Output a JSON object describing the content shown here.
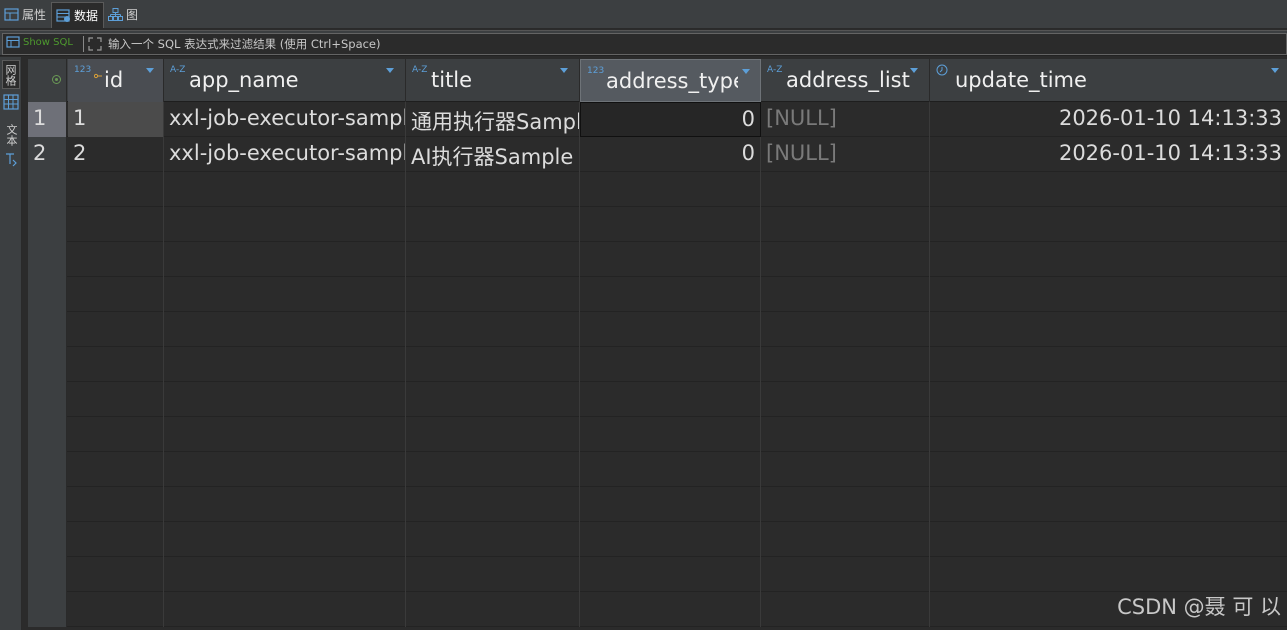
{
  "tabs": [
    {
      "label": "属性",
      "icon": "table-properties-icon"
    },
    {
      "label": "数据",
      "icon": "data-grid-icon",
      "active": true
    },
    {
      "label": "图",
      "icon": "diagram-icon"
    }
  ],
  "filter": {
    "show_sql_label": "Show SQL",
    "placeholder": "输入一个 SQL 表达式来过滤结果 (使用 Ctrl+Space)",
    "value": ""
  },
  "side_tabs": {
    "grid_label": "网格",
    "text_label": "文本"
  },
  "columns": [
    {
      "name": "id",
      "type_icon": "123",
      "key": true
    },
    {
      "name": "app_name",
      "type_icon": "A-Z"
    },
    {
      "name": "title",
      "type_icon": "A-Z"
    },
    {
      "name": "address_type",
      "type_icon": "123",
      "selected": true
    },
    {
      "name": "address_list",
      "type_icon": "A-Z"
    },
    {
      "name": "update_time",
      "type_icon": "clock"
    }
  ],
  "rows": [
    {
      "num": "1",
      "id": "1",
      "app_name": "xxl-job-executor-sample",
      "title": "通用执行器Sample",
      "address_type": "0",
      "address_list": "[NULL]",
      "update_time": "2026-01-10 14:13:33"
    },
    {
      "num": "2",
      "id": "2",
      "app_name": "xxl-job-executor-sample",
      "title": "AI执行器Sample",
      "address_type": "0",
      "address_list": "[NULL]",
      "update_time": "2026-01-10 14:13:33"
    }
  ],
  "watermark": "CSDN @聂 可 以",
  "colors": {
    "background": "#2b2b2b",
    "header": "#3c3f41",
    "type_icon": "#5d9fd8",
    "null_text": "#7a7a7a",
    "show_sql": "#4e9a2e"
  }
}
